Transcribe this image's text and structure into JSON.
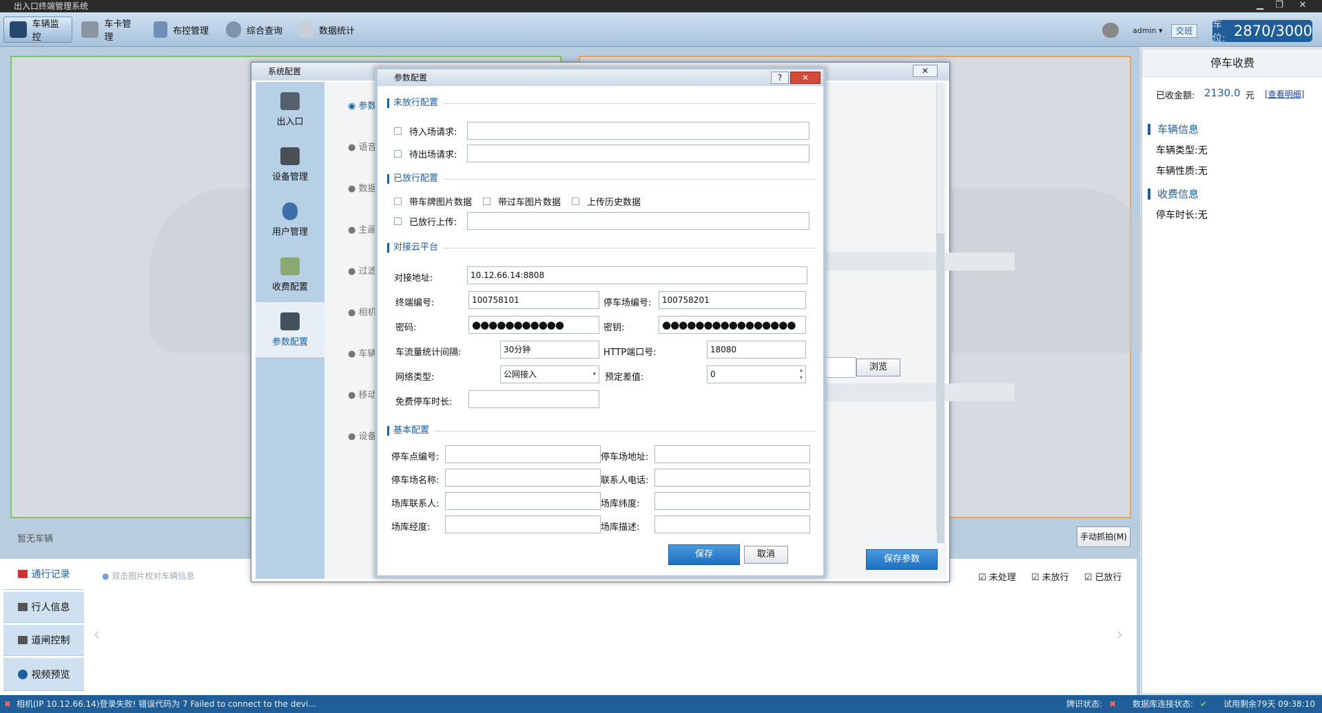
{
  "app": {
    "title": "出入口终端管理系统",
    "admin": "admin",
    "shift_btn": "交班",
    "slot_label": "车位:",
    "slot_value": "2870/3000"
  },
  "toolbar": {
    "items": [
      {
        "label": "车辆监控"
      },
      {
        "label": "车卡管理"
      },
      {
        "label": "布控管理"
      },
      {
        "label": "综合查询"
      },
      {
        "label": "数据统计"
      }
    ]
  },
  "monitor": {
    "no_vehicle": "暂无车辆",
    "manual_capture": "手动抓拍(M)"
  },
  "side": {
    "title": "停车收费",
    "collected_label": "已收金额:",
    "collected_value": "2130.0",
    "collected_unit": "元",
    "detail_link": "[查看明细]",
    "vehicle_info": "车辆信息",
    "vehicle_type": "车辆类型:无",
    "vehicle_nature": "车辆性质:无",
    "fee_info": "收费信息",
    "parking_duration": "停车时长:无"
  },
  "lower": {
    "tabs": [
      "通行记录",
      "行人信息",
      "道闸控制",
      "视频预览"
    ],
    "hint": "双击图片校对车辆信息",
    "filters": [
      "未处理",
      "未放行",
      "已放行"
    ]
  },
  "sysconfig": {
    "title": "系统配置",
    "nav": [
      "出入口",
      "设备管理",
      "用户管理",
      "收费配置",
      "参数配置"
    ],
    "options": [
      "参数",
      "语音",
      "数据",
      "主画",
      "过滤",
      "相机",
      "车辆",
      "移动",
      "设备"
    ],
    "browse": "浏览",
    "save_params": "保存参数"
  },
  "param": {
    "title": "参数配置",
    "g1": "未放行配置",
    "enter_req": "待入场请求:",
    "exit_req": "待出场请求:",
    "g2": "已放行配置",
    "plate_img": "带车牌图片数据",
    "pass_img": "带过车图片数据",
    "history": "上传历史数据",
    "released_upload": "已放行上传:",
    "g3": "对接云平台",
    "addr_label": "对接地址:",
    "addr_value": "10.12.66.14:8808",
    "term_label": "终端编号:",
    "term_value": "100758101",
    "lot_label": "停车场编号:",
    "lot_value": "100758201",
    "pwd_label": "密码:",
    "pwd_value": "●●●●●●●●●●●",
    "key_label": "密钥:",
    "key_value": "●●●●●●●●●●●●●●●●",
    "interval_label": "车流量统计间隔:",
    "interval_value": "30分钟",
    "http_label": "HTTP端口号:",
    "http_value": "18080",
    "net_label": "网络类型:",
    "net_value": "公网接入",
    "diff_label": "预定差值:",
    "diff_value": "0",
    "free_label": "免费停车时长:",
    "g4": "基本配置",
    "point_no": "停车点编号:",
    "lot_addr": "停车场地址:",
    "lot_name": "停车场名称:",
    "contact_phone": "联系人电话:",
    "lot_contact": "场库联系人:",
    "lat": "场库纬度:",
    "lng": "场库经度:",
    "desc": "场库描述:",
    "save": "保存",
    "cancel": "取消"
  },
  "status": {
    "error": "相机(IP 10.12.66.14)登录失败! 错误代码为 7 Failed to connect to the devi...",
    "plate_status": "牌识状态:",
    "db_status": "数据库连接状态:",
    "trial": "试用剩余79天 09:38:10"
  }
}
